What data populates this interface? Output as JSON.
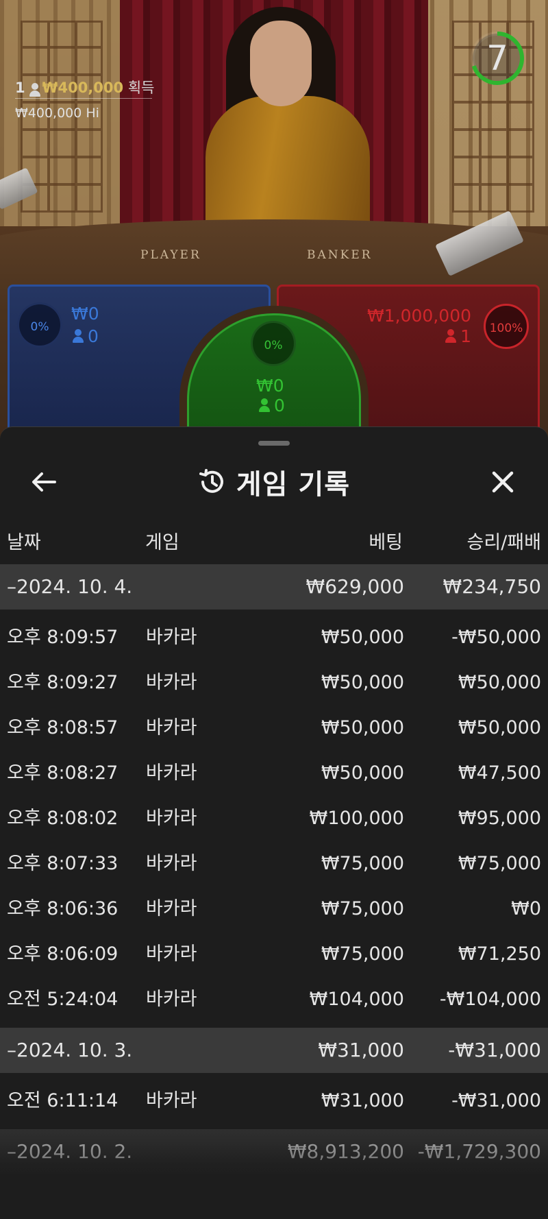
{
  "video": {
    "table_labels": {
      "player": "PLAYER",
      "banker": "BANKER"
    },
    "winners": {
      "count": "1",
      "amount": "₩400,000",
      "label": "획득"
    },
    "limit": "₩400,000  Hi",
    "timer": {
      "seconds": "7",
      "progress": 0.7
    }
  },
  "bets": {
    "player": {
      "percent": "0%",
      "amount": "₩0",
      "players": "0"
    },
    "tie": {
      "percent": "0%",
      "amount": "₩0",
      "players": "0"
    },
    "banker": {
      "percent": "100%",
      "amount": "₩1,000,000",
      "players": "1"
    }
  },
  "history": {
    "title": "게임 기록",
    "columns": {
      "date": "날짜",
      "game": "게임",
      "bet": "베팅",
      "result": "승리/패배"
    },
    "groups": [
      {
        "date": "–2024. 10. 4.",
        "bet": "₩629,000",
        "result": "₩234,750",
        "rows": [
          {
            "time": "오후 8:09:57",
            "game": "바카라",
            "bet": "₩50,000",
            "result": "-₩50,000"
          },
          {
            "time": "오후 8:09:27",
            "game": "바카라",
            "bet": "₩50,000",
            "result": "₩50,000"
          },
          {
            "time": "오후 8:08:57",
            "game": "바카라",
            "bet": "₩50,000",
            "result": "₩50,000"
          },
          {
            "time": "오후 8:08:27",
            "game": "바카라",
            "bet": "₩50,000",
            "result": "₩47,500"
          },
          {
            "time": "오후 8:08:02",
            "game": "바카라",
            "bet": "₩100,000",
            "result": "₩95,000"
          },
          {
            "time": "오후 8:07:33",
            "game": "바카라",
            "bet": "₩75,000",
            "result": "₩75,000"
          },
          {
            "time": "오후 8:06:36",
            "game": "바카라",
            "bet": "₩75,000",
            "result": "₩0"
          },
          {
            "time": "오후 8:06:09",
            "game": "바카라",
            "bet": "₩75,000",
            "result": "₩71,250"
          },
          {
            "time": "오전 5:24:04",
            "game": "바카라",
            "bet": "₩104,000",
            "result": "-₩104,000"
          }
        ]
      },
      {
        "date": "–2024. 10. 3.",
        "bet": "₩31,000",
        "result": "-₩31,000",
        "rows": [
          {
            "time": "오전 6:11:14",
            "game": "바카라",
            "bet": "₩31,000",
            "result": "-₩31,000"
          }
        ]
      },
      {
        "date": "–2024. 10. 2.",
        "bet": "₩8,913,200",
        "result": "-₩1,729,300",
        "rows": []
      }
    ]
  },
  "icons": {
    "back": "arrow-left-icon",
    "history": "history-clock-icon",
    "close": "close-x-icon",
    "person": "person-icon"
  },
  "colors": {
    "player": "#3a78d8",
    "banker": "#d0262b",
    "tie": "#33c233",
    "timer": "#2fb52f",
    "winner_amount": "#d8b85a"
  }
}
